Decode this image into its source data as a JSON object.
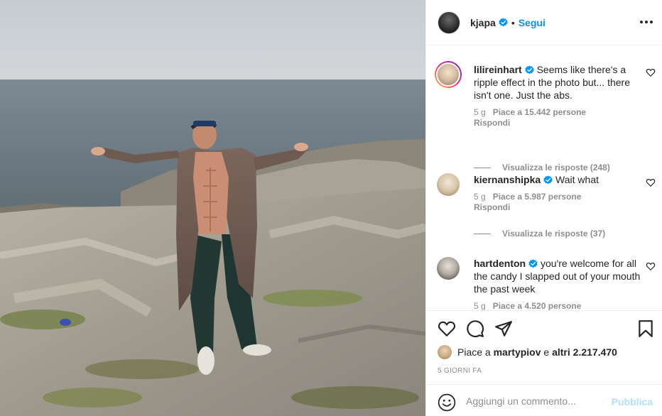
{
  "post": {
    "author": "kjapa",
    "separator": "•",
    "follow_label": "Segui",
    "verified_icon": "verified-badge-icon",
    "more_icon": "more-options-icon"
  },
  "comments": [
    {
      "user": "lilireinhart",
      "text": "Seems like there's a ripple effect in the photo but... there isn't one. Just the abs.",
      "age": "5 g",
      "likes": "Piace a 15.442 persone",
      "reply": "Rispondi",
      "view_replies": "Visualizza le risposte (248)"
    },
    {
      "user": "kiernanshipka",
      "text": "Wait what",
      "age": "5 g",
      "likes": "Piace a 5.987 persone",
      "reply": "Rispondi",
      "view_replies": "Visualizza le risposte (37)"
    },
    {
      "user": "hartdenton",
      "text": "you're welcome for all the candy I slapped out of your mouth the past week",
      "age": "5 g",
      "likes": "Piace a 4.520 persone"
    }
  ],
  "actions": {
    "like_icon": "heart-icon",
    "comment_icon": "comment-bubble-icon",
    "share_icon": "paper-plane-icon",
    "save_icon": "bookmark-icon"
  },
  "likes_summary": {
    "prefix": "Piace a ",
    "user": "martypiov",
    "middle": " e ",
    "others": "altri 2.217.470"
  },
  "date": "5 GIORNI FA",
  "add_comment": {
    "placeholder": "Aggiungi un commento...",
    "publish_label": "Pubblica",
    "emoji_icon": "emoji-icon"
  },
  "colors": {
    "link_blue": "#0095f6",
    "publish_disabled": "#b2dffc",
    "muted_text": "#8e8e8e",
    "text": "#262626",
    "border": "#efefef"
  }
}
